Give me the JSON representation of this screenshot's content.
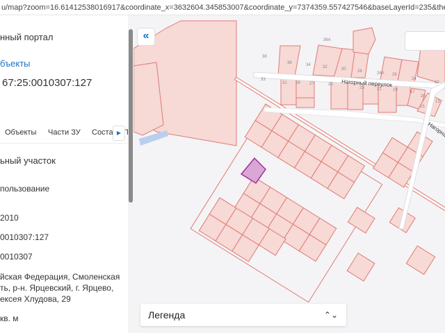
{
  "url": "u/map?zoom=16.61412538016917&coordinate_x=3632604.345853007&coordinate_y=7374359.557427546&baseLayerId=235&theme_id=1&is_copy_",
  "panel": {
    "portal_title": "нный портал",
    "objects_link": "бъекты",
    "cadastral_number": "67:25:0010307:127",
    "tabs": [
      "Объекты",
      "Части ЗУ",
      "Соста"
    ],
    "tab_overflow": "Т",
    "fields": [
      "ьный участок",
      "пользование",
      "2010",
      "0010307:127",
      "0010307",
      "йская Федерация, Смоленская",
      "ть, р-н. Ярцевский, г. Ярцево,",
      "ексея Хлудова, 29",
      "кв. м"
    ]
  },
  "map": {
    "street1": "Нагорный переулок",
    "street2": "Нагорна",
    "house_numbers": [
      "36А",
      "38",
      "36",
      "34",
      "32",
      "30",
      "28",
      "26А",
      "33",
      "31",
      "29",
      "27",
      "25",
      "23",
      "21",
      "19",
      "17",
      "26",
      "24",
      "22",
      "20",
      "15",
      "13"
    ],
    "legend_label": "Легенда"
  },
  "colors": {
    "parcel_fill": "#f7d9d6",
    "parcel_stroke": "#e07a72",
    "selected_fill": "#d9a6d6",
    "selected_stroke": "#a0309a",
    "accent": "#1a73c8"
  }
}
